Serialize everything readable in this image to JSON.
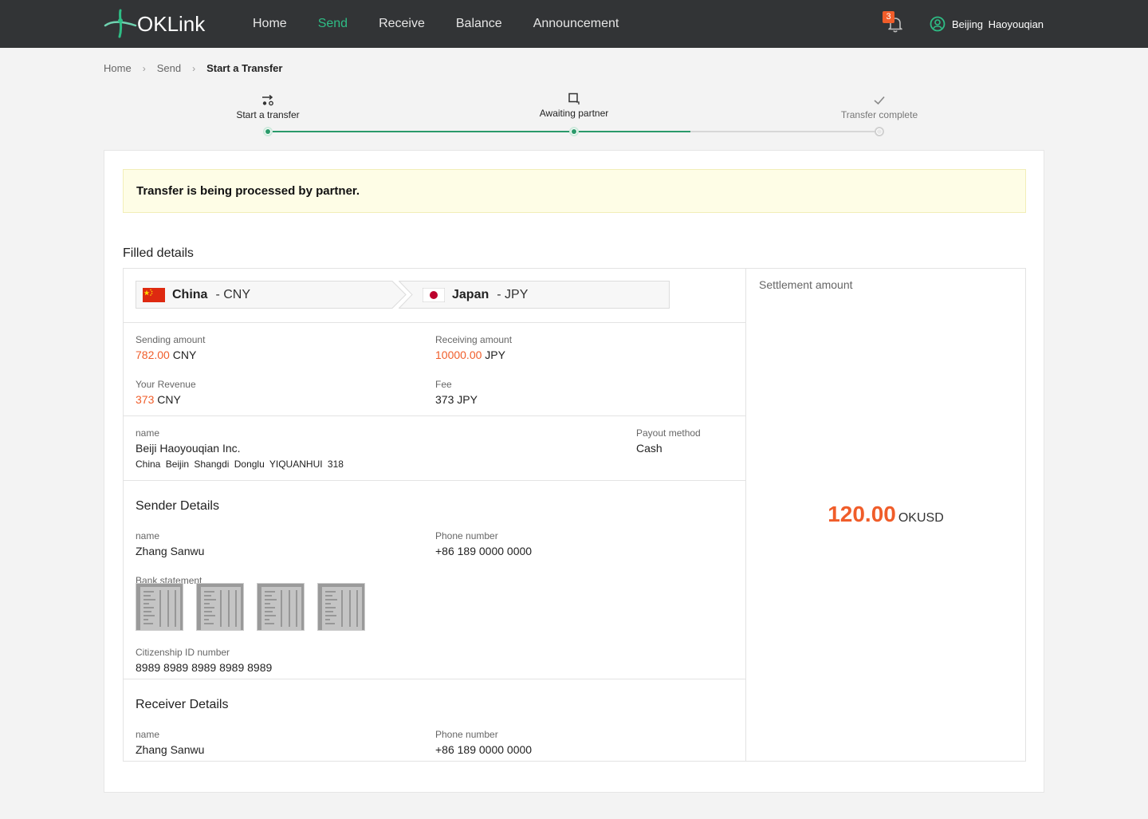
{
  "app": {
    "logo_text": "OKLink"
  },
  "nav": {
    "items": [
      {
        "label": "Home",
        "active": false
      },
      {
        "label": "Send",
        "active": true
      },
      {
        "label": "Receive",
        "active": false
      },
      {
        "label": "Balance",
        "active": false
      },
      {
        "label": "Announcement",
        "active": false
      }
    ],
    "notifications_count": "3",
    "user_name": "Beijing Haoyouqian"
  },
  "breadcrumb": {
    "home": "Home",
    "send": "Send",
    "current": "Start a Transfer"
  },
  "steps": {
    "s1": "Start a transfer",
    "s2": "Awaiting partner",
    "s3": "Transfer complete"
  },
  "notice": "Transfer is being processed by partner.",
  "section_title": "Filled details",
  "corridor": {
    "from": {
      "country": "China",
      "currency": "- CNY"
    },
    "to": {
      "country": "Japan",
      "currency": "- JPY"
    }
  },
  "amounts": {
    "sending_label": "Sending amount",
    "sending_value": "782.00",
    "sending_unit": "CNY",
    "receiving_label": "Receiving amount",
    "receiving_value": "10000.00",
    "receiving_unit": "JPY",
    "revenue_label": "Your Revenue",
    "revenue_value": "373",
    "revenue_unit": "CNY",
    "fee_label": "Fee",
    "fee_value": "373 JPY"
  },
  "partner": {
    "name_label": "name",
    "name": "Beiji Haoyouqian Inc.",
    "address": "China  Beijin  Shangdi Donglu YIQUANHUI 318",
    "payout_label": "Payout method",
    "payout": "Cash"
  },
  "sender": {
    "title": "Sender Details",
    "name_label": "name",
    "name": "Zhang Sanwu",
    "phone_label": "Phone number",
    "phone": "+86 189 0000 0000",
    "bank_label": "Bank statement",
    "id_label": "Citizenship ID number",
    "id": "8989 8989 8989 8989 8989"
  },
  "receiver": {
    "title": "Receiver Details",
    "name_label": "name",
    "name": "Zhang Sanwu",
    "phone_label": "Phone number",
    "phone": "+86 189 0000 0000"
  },
  "settlement": {
    "label": "Settlement amount",
    "amount": "120.00",
    "unit": "OKUSD"
  },
  "colors": {
    "accent": "#2ebd85",
    "orange": "#f05d2a",
    "topbar": "#323436"
  }
}
